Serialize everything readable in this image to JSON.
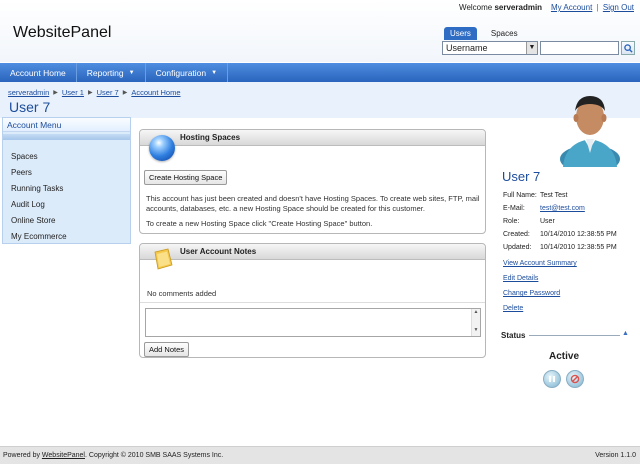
{
  "header": {
    "welcome_prefix": "Welcome",
    "username": "serveradmin",
    "my_account": "My Account",
    "separator": "|",
    "sign_out": "Sign Out",
    "logo": "WebsitePanel"
  },
  "search": {
    "tabs": [
      "Users",
      "Spaces"
    ],
    "select_value": "Username",
    "input_value": ""
  },
  "nav": {
    "items": [
      {
        "label": "Account Home",
        "dropdown": false
      },
      {
        "label": "Reporting",
        "dropdown": true
      },
      {
        "label": "Configuration",
        "dropdown": true
      }
    ]
  },
  "breadcrumb": [
    "serveradmin",
    "User 1",
    "User 7",
    "Account Home"
  ],
  "page_title": "User 7",
  "account_menu": {
    "title": "Account Menu",
    "items": [
      "Spaces",
      "Peers",
      "Running Tasks",
      "Audit Log",
      "Online Store",
      "My Ecommerce"
    ]
  },
  "hosting_spaces": {
    "title": "Hosting Spaces",
    "create_button": "Create Hosting Space",
    "text1": "This account has just been created and doesn't have Hosting Spaces. To create web sites, FTP, mail accounts, databases, etc. a new Hosting Space should be created for this customer.",
    "text2": "To create a new Hosting Space click \"Create Hosting Space\" button."
  },
  "notes": {
    "title": "User Account Notes",
    "empty_text": "No comments added",
    "add_button": "Add Notes",
    "textarea_value": ""
  },
  "profile": {
    "name": "User 7",
    "full_name_label": "Full Name:",
    "full_name": "Test Test",
    "email_label": "E-Mail:",
    "email": "test@test.com",
    "role_label": "Role:",
    "role": "User",
    "created_label": "Created:",
    "created": "10/14/2010 12:38:55 PM",
    "updated_label": "Updated:",
    "updated": "10/14/2010 12:38:55 PM",
    "links": [
      "View Account Summary",
      "Edit Details",
      "Change Password",
      "Delete"
    ]
  },
  "status": {
    "title": "Status",
    "value": "Active"
  },
  "footer": {
    "powered_by": "Powered by",
    "product_link": "WebsitePanel",
    "copyright": ". Copyright © 2010 SMB SAAS Systems Inc.",
    "version": "Version 1.1.0"
  },
  "colors": {
    "nav": "#2a64bd",
    "link": "#1c4c9c",
    "menu_bg": "#dcebfa"
  }
}
